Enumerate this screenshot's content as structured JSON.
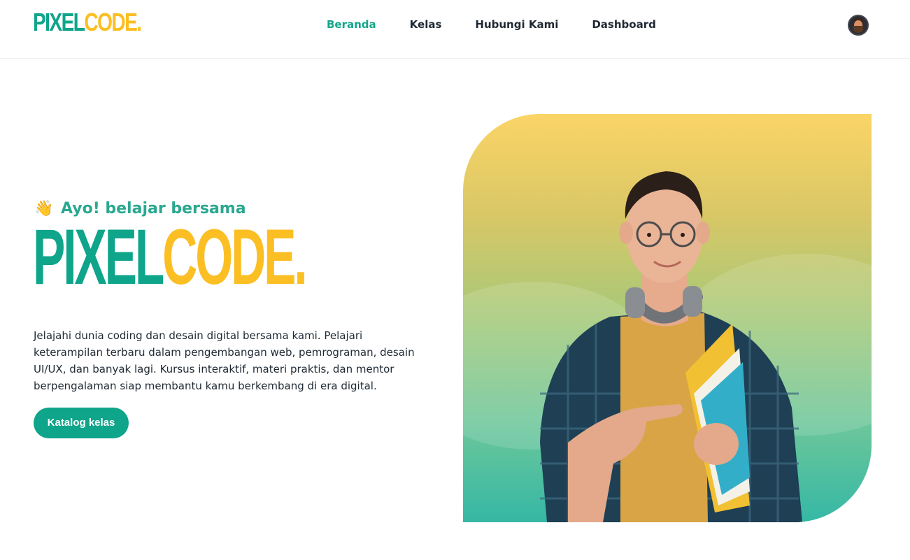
{
  "brand": {
    "logo_part1": "PIXEL",
    "logo_part2": "CODE."
  },
  "nav": {
    "items": [
      {
        "label": "Beranda",
        "active": true
      },
      {
        "label": "Kelas",
        "active": false
      },
      {
        "label": "Hubungi Kami",
        "active": false
      },
      {
        "label": "Dashboard",
        "active": false
      }
    ]
  },
  "hero": {
    "greeting_icon": "waving-hand-icon",
    "greeting": "Ayo! belajar bersama",
    "title_part1": "PIXEL",
    "title_part2": "CODE.",
    "description": "Jelajahi dunia coding dan desain digital bersama kami. Pelajari keterampilan terbaru dalam pengembangan web, pemrograman, desain UI/UX, dan banyak lagi. Kursus interaktif, materi praktis, dan mentor berpengalaman siap membantu kamu berkembang di era digital.",
    "cta_label": "Katalog kelas"
  },
  "colors": {
    "primary": "#0ea58a",
    "accent": "#fbbf24",
    "text": "#1f2933"
  }
}
